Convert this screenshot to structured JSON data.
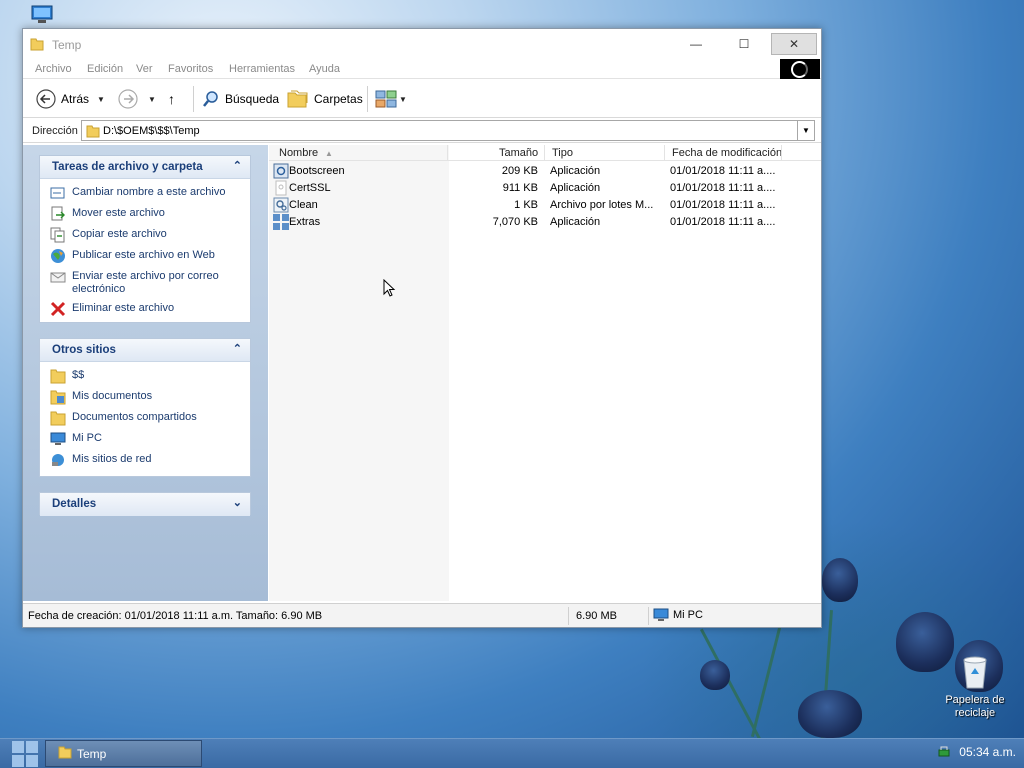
{
  "window": {
    "title": "Temp",
    "minimize_glyph": "—",
    "maximize_glyph": "☐",
    "close_glyph": "✕"
  },
  "menu": [
    "Archivo",
    "Edición",
    "Ver",
    "Favoritos",
    "Herramientas",
    "Ayuda"
  ],
  "toolbar": {
    "back_label": "Atrás",
    "search_label": "Búsqueda",
    "folders_label": "Carpetas",
    "dropdown_glyph": "▼",
    "up_glyph": "↑"
  },
  "address": {
    "label": "Dirección",
    "value": "D:\\$OEM$\\$$\\Temp",
    "dropdown_glyph": "▼"
  },
  "tasks_panel": {
    "title": "Tareas de archivo y carpeta",
    "toggle_glyph": "⌃",
    "items": [
      {
        "label": "Cambiar nombre a este archivo",
        "icon": "rename-icon"
      },
      {
        "label": "Mover este archivo",
        "icon": "move-icon"
      },
      {
        "label": "Copiar este archivo",
        "icon": "copy-icon"
      },
      {
        "label": "Publicar este archivo en Web",
        "icon": "publish-web-icon"
      },
      {
        "label": "Enviar este archivo por correo electrónico",
        "icon": "email-icon"
      },
      {
        "label": "Eliminar este archivo",
        "icon": "delete-icon"
      }
    ]
  },
  "places_panel": {
    "title": "Otros sitios",
    "toggle_glyph": "⌃",
    "items": [
      {
        "label": "$$",
        "icon": "folder-icon"
      },
      {
        "label": "Mis documentos",
        "icon": "documents-icon"
      },
      {
        "label": "Documentos compartidos",
        "icon": "folder-icon"
      },
      {
        "label": "Mi PC",
        "icon": "computer-icon"
      },
      {
        "label": "Mis sitios de red",
        "icon": "network-icon"
      }
    ]
  },
  "details_panel": {
    "title": "Detalles",
    "toggle_glyph": "⌄"
  },
  "file_list": {
    "columns": [
      "Nombre",
      "Tamaño",
      "Tipo",
      "Fecha de modificación"
    ],
    "sort_glyph": "▲",
    "rows": [
      {
        "name": "Bootscreen",
        "size": "209 KB",
        "type": "Aplicación",
        "date": "01/01/2018 11:11 a....",
        "icon": "app-icon"
      },
      {
        "name": "CertSSL",
        "size": "911 KB",
        "type": "Aplicación",
        "date": "01/01/2018 11:11 a....",
        "icon": "certificate-icon"
      },
      {
        "name": "Clean",
        "size": "1 KB",
        "type": "Archivo por lotes M...",
        "date": "01/01/2018 11:11 a....",
        "icon": "batch-file-icon"
      },
      {
        "name": "Extras",
        "size": "7,070 KB",
        "type": "Aplicación",
        "date": "01/01/2018 11:11 a....",
        "icon": "app-grid-icon"
      }
    ]
  },
  "status": {
    "text": "Fecha de creación: 01/01/2018 11:11 a.m. Tamaño: 6.90 MB",
    "size": "6.90 MB",
    "location": "Mi PC"
  },
  "desktop": {
    "recycle_bin_label": "Papelera de reciclaje"
  },
  "taskbar": {
    "task_label": "Temp",
    "clock": "05:34 a.m."
  }
}
